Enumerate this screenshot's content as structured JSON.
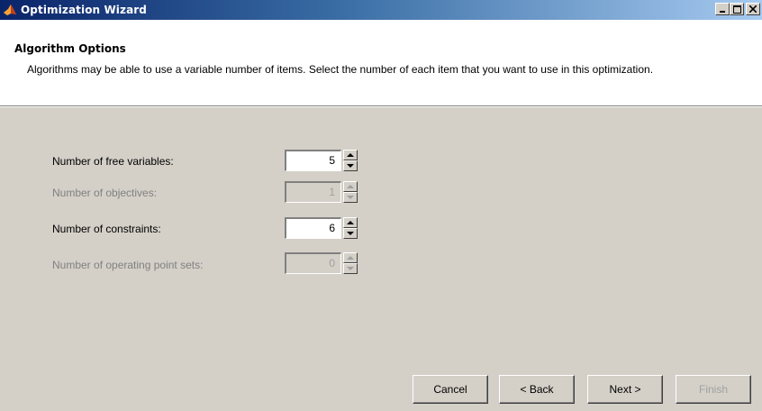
{
  "window": {
    "title": "Optimization Wizard",
    "app_icon": "matlab-icon"
  },
  "header": {
    "title": "Algorithm Options",
    "description": "Algorithms may be able to use a variable number of items.  Select the number of each item that you want to use in this optimization."
  },
  "options": [
    {
      "label": "Number of free variables:",
      "value": "5",
      "enabled": true
    },
    {
      "label": "Number of objectives:",
      "value": "1",
      "enabled": false
    },
    {
      "label": "Number of constraints:",
      "value": "6",
      "enabled": true
    },
    {
      "label": "Number of operating point sets:",
      "value": "0",
      "enabled": false
    }
  ],
  "buttons": {
    "cancel": "Cancel",
    "back": "< Back",
    "next": "Next >",
    "finish": "Finish"
  }
}
